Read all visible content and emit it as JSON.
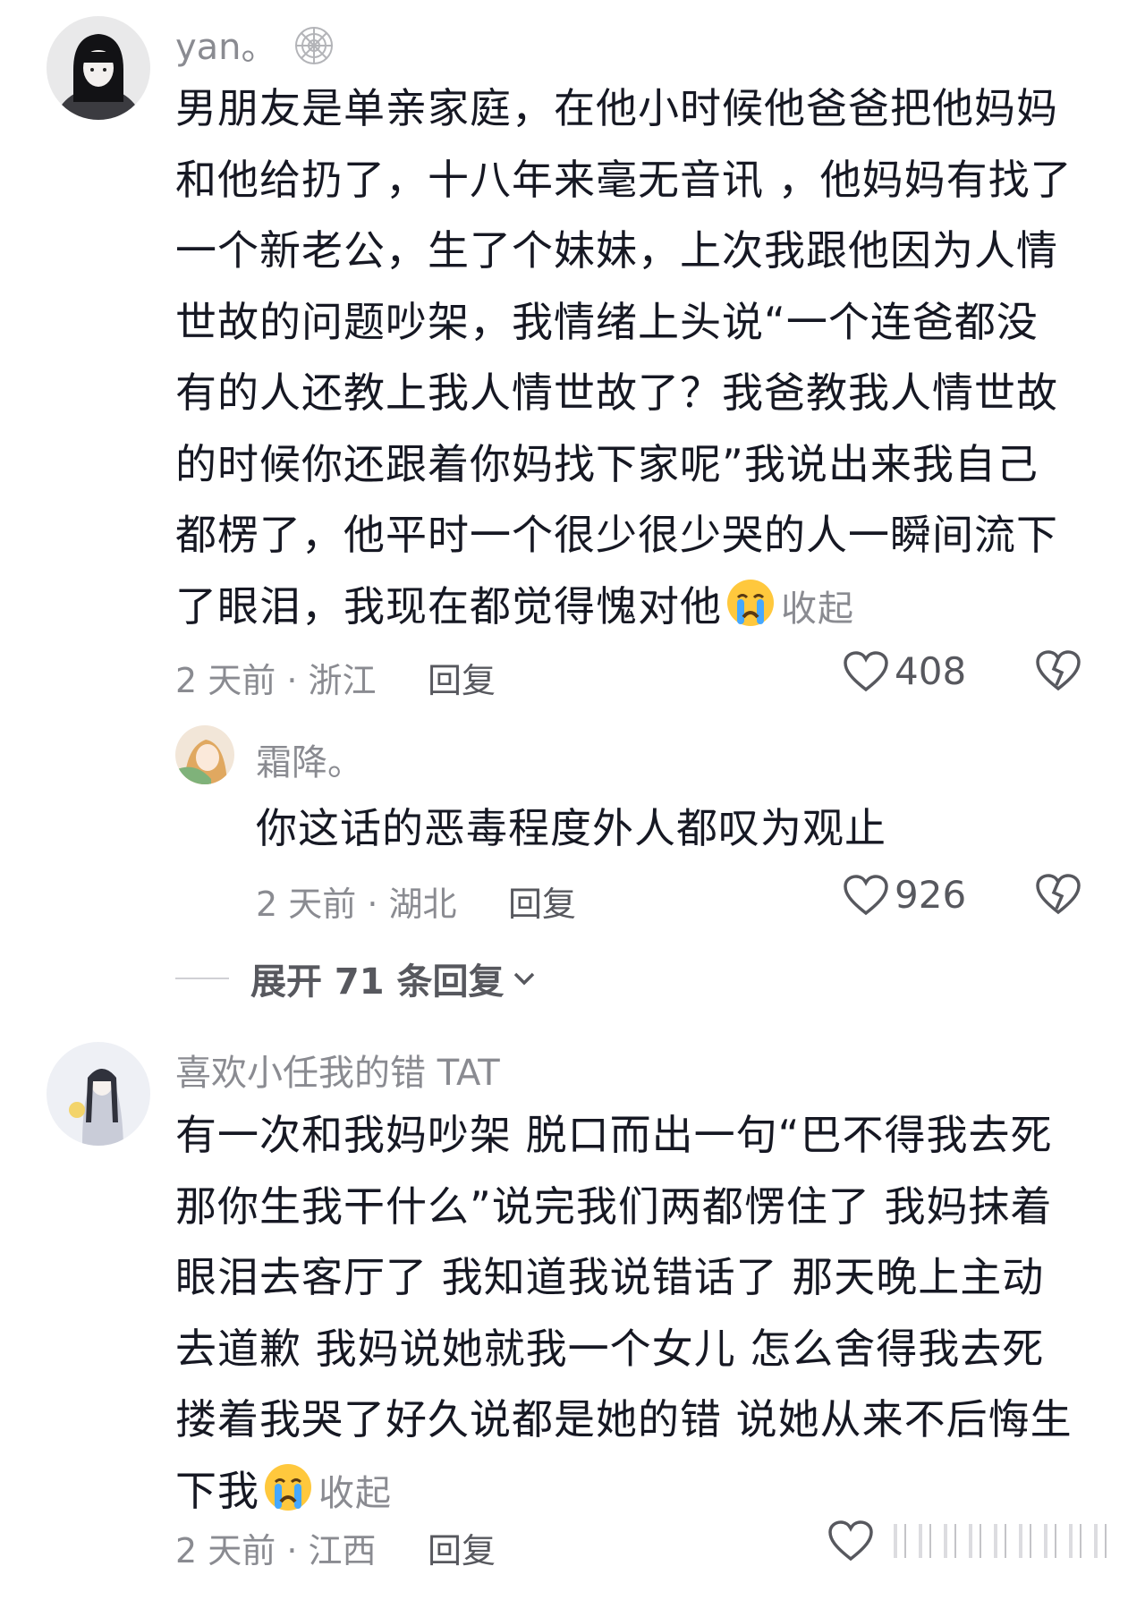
{
  "comments": [
    {
      "username": "yan。",
      "username_icon": "spiderweb-icon",
      "lines": [
        "男朋友是单亲家庭，在他小时候他爸爸把他妈妈",
        "和他给扔了，十八年来毫无音讯 ，他妈妈有找了",
        "一个新老公，生了个妹妹，上次我跟他因为人情",
        "世故的问题吵架，我情绪上头说“一个连爸都没",
        "有的人还教上我人情世故了？我爸教我人情世故",
        "的时候你还跟着你妈找下家呢”我说出来我自己",
        "都楞了，他平时一个很少很少哭的人一瞬间流下",
        "了眼泪，我现在都觉得愧对他"
      ],
      "emoji": "crying-face-icon",
      "collapse": "收起",
      "meta": "2 天前 · 浙江",
      "reply": "回复",
      "likes": "408"
    },
    {
      "username": "霜降。",
      "text": "你这话的恶毒程度外人都叹为观止",
      "meta": "2 天前 · 湖北",
      "reply": "回复",
      "likes": "926"
    },
    {
      "username": "喜欢小任我的错 TAT",
      "lines": [
        "有一次和我妈吵架 脱口而出一句“巴不得我去死",
        "那你生我干什么”说完我们两都愣住了 我妈抹着",
        "眼泪去客厅了 我知道我说错话了 那天晚上主动",
        "去道歉 我妈说她就我一个女儿 怎么舍得我去死",
        "搂着我哭了好久说都是她的错 说她从来不后悔生",
        "下我"
      ],
      "emoji": "crying-face-icon",
      "collapse": "收起",
      "meta": "2 天前 · 江西",
      "reply": "回复"
    }
  ],
  "expand_replies": "展开 71 条回复"
}
